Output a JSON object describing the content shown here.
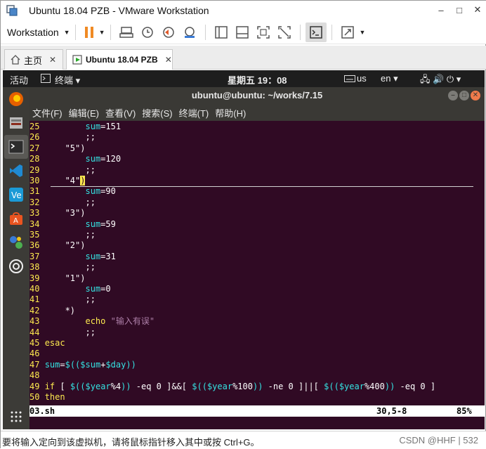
{
  "window": {
    "title": "Ubuntu 18.04 PZB - VMware Workstation",
    "min": "–",
    "max": "□",
    "close": "✕"
  },
  "toolbar": {
    "workstation_label": "Workstation",
    "dropdown": "▼"
  },
  "tabs": [
    {
      "label": "主页",
      "close": "✕"
    },
    {
      "label": "Ubuntu 18.04 PZB",
      "close": "✕"
    }
  ],
  "ubuntu_topbar": {
    "activities": "活动",
    "app_menu": "终端 ▾",
    "clock": "星期五 19：08",
    "kbd": "us",
    "lang": "en ▾",
    "indicators": "🖧  🔊  ⏻ ▾"
  },
  "terminal": {
    "title": "ubuntu@ubuntu: ~/works/7.15",
    "menus": [
      "文件(F)",
      "编辑(E)",
      "查看(V)",
      "搜索(S)",
      "终端(T)",
      "帮助(H)"
    ],
    "lines": [
      {
        "n": "25",
        "t": "        sum=151"
      },
      {
        "n": "26",
        "t": "        ;;"
      },
      {
        "n": "27",
        "t": "    \"5\")"
      },
      {
        "n": "28",
        "t": "        sum=120"
      },
      {
        "n": "29",
        "t": "        ;;"
      },
      {
        "n": "30",
        "t": "    \"4\")"
      },
      {
        "n": "31",
        "t": "        sum=90"
      },
      {
        "n": "32",
        "t": "        ;;"
      },
      {
        "n": "33",
        "t": "    \"3\")"
      },
      {
        "n": "34",
        "t": "        sum=59"
      },
      {
        "n": "35",
        "t": "        ;;"
      },
      {
        "n": "36",
        "t": "    \"2\")"
      },
      {
        "n": "37",
        "t": "        sum=31"
      },
      {
        "n": "38",
        "t": "        ;;"
      },
      {
        "n": "39",
        "t": "    \"1\")"
      },
      {
        "n": "40",
        "t": "        sum=0"
      },
      {
        "n": "41",
        "t": "        ;;"
      },
      {
        "n": "42",
        "t": "    *)"
      },
      {
        "n": "43",
        "t": "        echo \"输入有误\""
      },
      {
        "n": "44",
        "t": "        ;;"
      },
      {
        "n": "45",
        "t": "esac"
      },
      {
        "n": "46",
        "t": ""
      },
      {
        "n": "47",
        "t": "sum=$(($sum+$day))"
      },
      {
        "n": "48",
        "t": ""
      },
      {
        "n": "49",
        "t": "if [ $(($year%4)) -eq 0 ]&&[ $(($year%100)) -ne 0 ]||[ $(($year%400)) -eq 0 ]"
      },
      {
        "n": "50",
        "t": "then"
      }
    ],
    "status": {
      "file": "03.sh",
      "position": "30,5-8",
      "percent": "85%"
    }
  },
  "statusbar": {
    "hint": "要将输入定向到该虚拟机，请将鼠标指针移入其中或按 Ctrl+G。",
    "watermark": "CSDN @HHF | 532"
  },
  "colors": {
    "terminal_bg": "#300a24",
    "line_number": "#fce94f",
    "variable": "#34e2e2",
    "string": "#ad7fa8"
  }
}
